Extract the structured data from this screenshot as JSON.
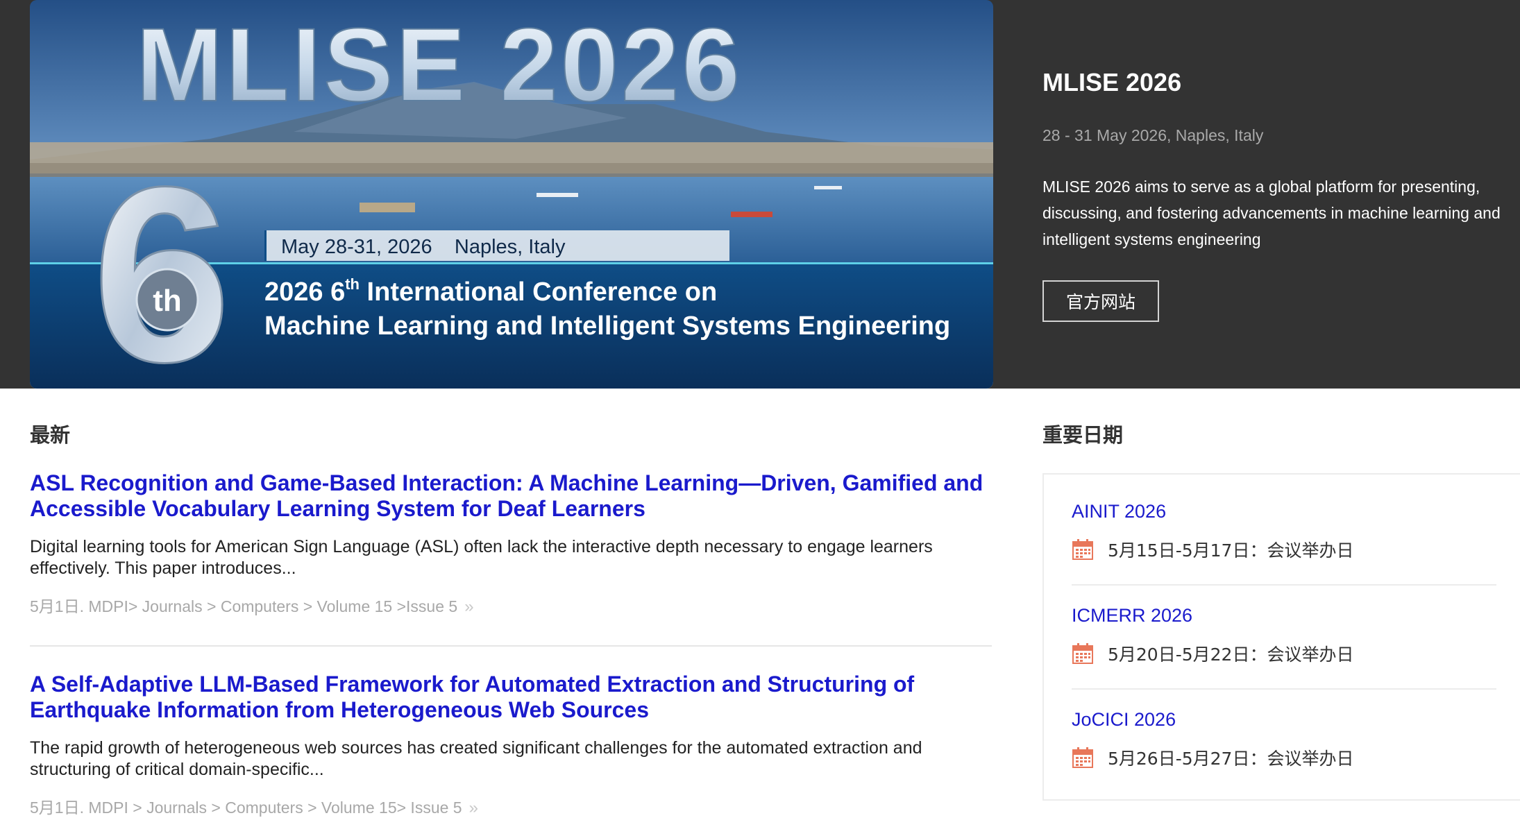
{
  "banner": {
    "headline": "MLISE 2026",
    "ordinal_number": "6",
    "ordinal_suffix": "th",
    "date_location": "May 28-31, 2026    Naples, Italy",
    "conf_line1_pre": "2026 6",
    "conf_line1_sup": "th",
    "conf_line1_post": " International Conference on",
    "conf_line2": "Machine Learning and Intelligent Systems Engineering"
  },
  "hero": {
    "title": "MLISE 2026",
    "date_location": "28 - 31 May 2026, Naples, Italy",
    "description": "MLISE 2026 aims to serve as a global platform for presenting, discussing, and fostering advancements in machine learning and intelligent systems engineering",
    "button_label": "官方网站"
  },
  "news": {
    "heading": "最新",
    "articles": [
      {
        "title": "ASL Recognition and Game-Based Interaction: A Machine Learning—Driven, Gamified and Accessible Vocabulary Learning System for Deaf Learners",
        "summary": "Digital learning tools for American Sign Language (ASL) often lack the interactive depth necessary to engage learners effectively. This paper introduces...",
        "meta": "5月1日. MDPI> Journals > Computers > Volume 15 >Issue 5",
        "more": "»"
      },
      {
        "title": "A Self-Adaptive LLM-Based Framework for Automated Extraction and Structuring of Earthquake Information from Heterogeneous Web Sources",
        "summary": "The rapid growth of heterogeneous web sources has created significant challenges for the automated extraction and structuring of critical domain-specific...",
        "meta": "5月1日. MDPI > Journals > Computers > Volume 15> Issue 5",
        "more": "»"
      }
    ]
  },
  "dates": {
    "heading": "重要日期",
    "items": [
      {
        "name": "AINIT 2026",
        "date": "5月15日-5月17日：会议举办日"
      },
      {
        "name": "ICMERR 2026",
        "date": "5月20日-5月22日：会议举办日"
      },
      {
        "name": "JoCICI 2026",
        "date": "5月26日-5月27日：会议举办日"
      }
    ]
  },
  "colors": {
    "hero_background": "#333333",
    "link_blue": "#1a1acc",
    "meta_gray": "#a8a8a8",
    "calendar_icon": "#e8775a",
    "banner_strip": "#0f4f86"
  }
}
